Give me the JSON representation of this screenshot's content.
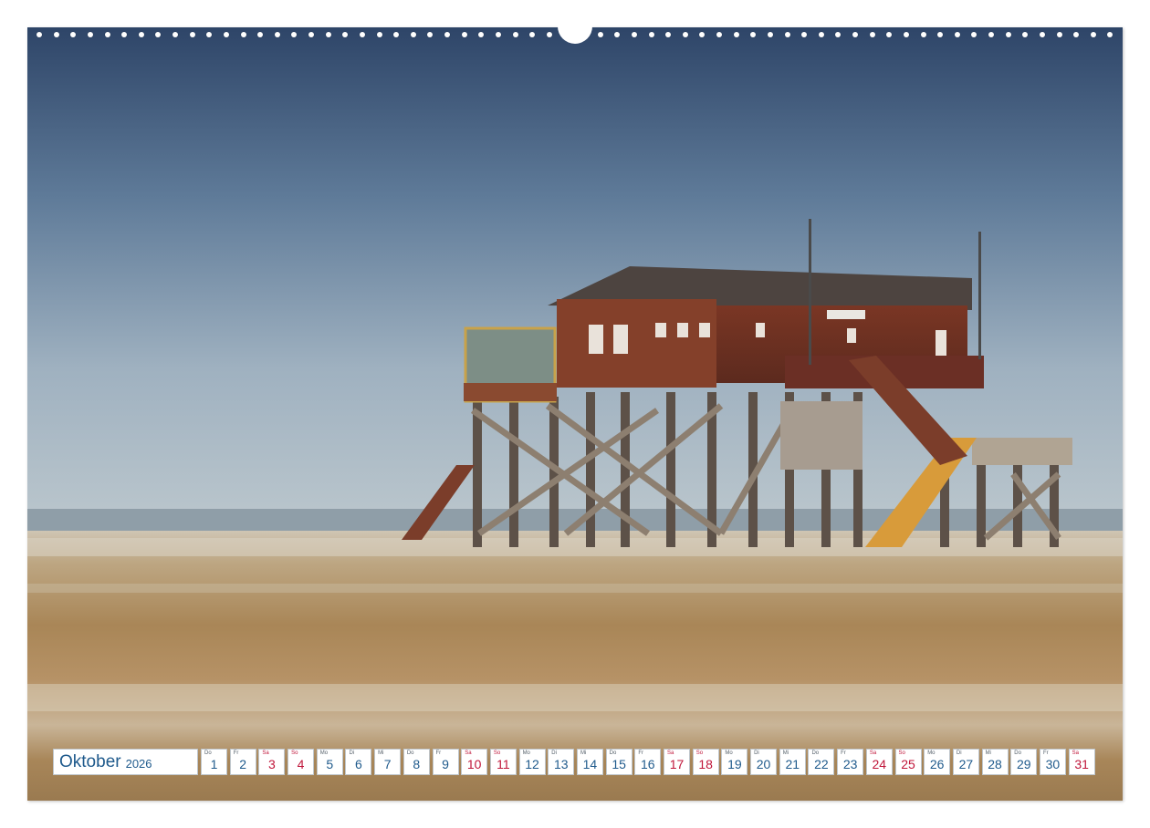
{
  "calendar": {
    "month": "Oktober",
    "year": "2026",
    "days": [
      {
        "wd": "Do",
        "n": "1",
        "weekend": false
      },
      {
        "wd": "Fr",
        "n": "2",
        "weekend": false
      },
      {
        "wd": "Sa",
        "n": "3",
        "weekend": true
      },
      {
        "wd": "So",
        "n": "4",
        "weekend": true
      },
      {
        "wd": "Mo",
        "n": "5",
        "weekend": false
      },
      {
        "wd": "Di",
        "n": "6",
        "weekend": false
      },
      {
        "wd": "Mi",
        "n": "7",
        "weekend": false
      },
      {
        "wd": "Do",
        "n": "8",
        "weekend": false
      },
      {
        "wd": "Fr",
        "n": "9",
        "weekend": false
      },
      {
        "wd": "Sa",
        "n": "10",
        "weekend": true
      },
      {
        "wd": "So",
        "n": "11",
        "weekend": true
      },
      {
        "wd": "Mo",
        "n": "12",
        "weekend": false
      },
      {
        "wd": "Di",
        "n": "13",
        "weekend": false
      },
      {
        "wd": "Mi",
        "n": "14",
        "weekend": false
      },
      {
        "wd": "Do",
        "n": "15",
        "weekend": false
      },
      {
        "wd": "Fr",
        "n": "16",
        "weekend": false
      },
      {
        "wd": "Sa",
        "n": "17",
        "weekend": true
      },
      {
        "wd": "So",
        "n": "18",
        "weekend": true
      },
      {
        "wd": "Mo",
        "n": "19",
        "weekend": false
      },
      {
        "wd": "Di",
        "n": "20",
        "weekend": false
      },
      {
        "wd": "Mi",
        "n": "21",
        "weekend": false
      },
      {
        "wd": "Do",
        "n": "22",
        "weekend": false
      },
      {
        "wd": "Fr",
        "n": "23",
        "weekend": false
      },
      {
        "wd": "Sa",
        "n": "24",
        "weekend": true
      },
      {
        "wd": "So",
        "n": "25",
        "weekend": true
      },
      {
        "wd": "Mo",
        "n": "26",
        "weekend": false
      },
      {
        "wd": "Di",
        "n": "27",
        "weekend": false
      },
      {
        "wd": "Mi",
        "n": "28",
        "weekend": false
      },
      {
        "wd": "Do",
        "n": "29",
        "weekend": false
      },
      {
        "wd": "Fr",
        "n": "30",
        "weekend": false
      },
      {
        "wd": "Sa",
        "n": "31",
        "weekend": true
      }
    ]
  },
  "colors": {
    "weekday_number": "#1f5a8c",
    "weekend_number": "#c0163a",
    "sky_top": "#2f4a6e",
    "sand": "#a78455"
  }
}
